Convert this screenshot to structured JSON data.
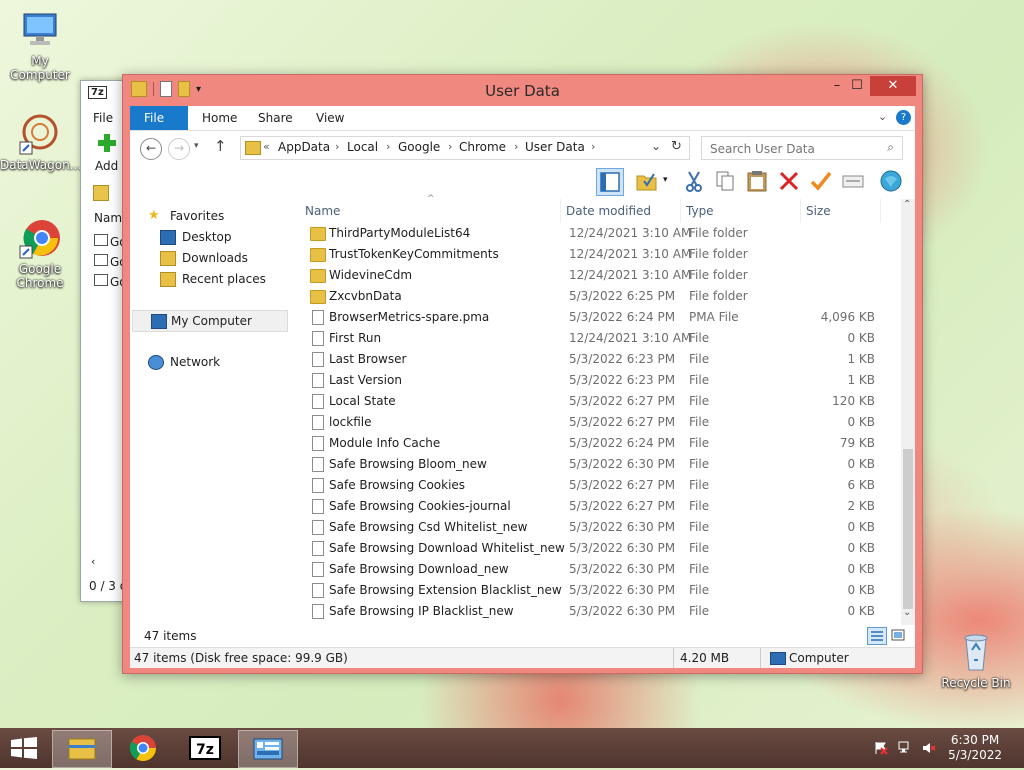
{
  "desktop": {
    "icons": [
      {
        "label": "My Computer"
      },
      {
        "label": "DataWagon..."
      },
      {
        "label": "Google Chrome"
      },
      {
        "label": "Recycle Bin"
      }
    ]
  },
  "back_window": {
    "title_icon": "7z",
    "menu_file": "File",
    "add_label": "Add",
    "col_name": "Name",
    "rows": [
      "Go",
      "Go",
      "Go"
    ],
    "status": "0 / 3 o"
  },
  "window": {
    "title": "User Data",
    "controls": {
      "minimize": "–",
      "maximize": "☐",
      "close": "✕"
    },
    "ribbon_tabs": [
      "File",
      "Home",
      "Share",
      "View"
    ],
    "address": {
      "prefix": "«",
      "crumbs": [
        "AppData",
        "Local",
        "Google",
        "Chrome",
        "User Data"
      ]
    },
    "search_placeholder": "Search User Data",
    "nav": {
      "favorites": "Favorites",
      "desktop": "Desktop",
      "downloads": "Downloads",
      "recent": "Recent places",
      "my_computer": "My Computer",
      "network": "Network"
    },
    "columns": {
      "name": "Name",
      "date": "Date modified",
      "type": "Type",
      "size": "Size"
    },
    "files": [
      {
        "name": "ThirdPartyModuleList64",
        "date": "12/24/2021 3:10 AM",
        "type": "File folder",
        "size": "",
        "kind": "folder"
      },
      {
        "name": "TrustTokenKeyCommitments",
        "date": "12/24/2021 3:10 AM",
        "type": "File folder",
        "size": "",
        "kind": "folder"
      },
      {
        "name": "WidevineCdm",
        "date": "12/24/2021 3:10 AM",
        "type": "File folder",
        "size": "",
        "kind": "folder"
      },
      {
        "name": "ZxcvbnData",
        "date": "5/3/2022 6:25 PM",
        "type": "File folder",
        "size": "",
        "kind": "folder"
      },
      {
        "name": "BrowserMetrics-spare.pma",
        "date": "5/3/2022 6:24 PM",
        "type": "PMA File",
        "size": "4,096 KB",
        "kind": "file"
      },
      {
        "name": "First Run",
        "date": "12/24/2021 3:10 AM",
        "type": "File",
        "size": "0 KB",
        "kind": "file"
      },
      {
        "name": "Last Browser",
        "date": "5/3/2022 6:23 PM",
        "type": "File",
        "size": "1 KB",
        "kind": "file"
      },
      {
        "name": "Last Version",
        "date": "5/3/2022 6:23 PM",
        "type": "File",
        "size": "1 KB",
        "kind": "file"
      },
      {
        "name": "Local State",
        "date": "5/3/2022 6:27 PM",
        "type": "File",
        "size": "120 KB",
        "kind": "file"
      },
      {
        "name": "lockfile",
        "date": "5/3/2022 6:27 PM",
        "type": "File",
        "size": "0 KB",
        "kind": "file"
      },
      {
        "name": "Module Info Cache",
        "date": "5/3/2022 6:24 PM",
        "type": "File",
        "size": "79 KB",
        "kind": "file"
      },
      {
        "name": "Safe Browsing Bloom_new",
        "date": "5/3/2022 6:30 PM",
        "type": "File",
        "size": "0 KB",
        "kind": "file"
      },
      {
        "name": "Safe Browsing Cookies",
        "date": "5/3/2022 6:27 PM",
        "type": "File",
        "size": "6 KB",
        "kind": "file"
      },
      {
        "name": "Safe Browsing Cookies-journal",
        "date": "5/3/2022 6:27 PM",
        "type": "File",
        "size": "2 KB",
        "kind": "file"
      },
      {
        "name": "Safe Browsing Csd Whitelist_new",
        "date": "5/3/2022 6:30 PM",
        "type": "File",
        "size": "0 KB",
        "kind": "file"
      },
      {
        "name": "Safe Browsing Download Whitelist_new",
        "date": "5/3/2022 6:30 PM",
        "type": "File",
        "size": "0 KB",
        "kind": "file"
      },
      {
        "name": "Safe Browsing Download_new",
        "date": "5/3/2022 6:30 PM",
        "type": "File",
        "size": "0 KB",
        "kind": "file"
      },
      {
        "name": "Safe Browsing Extension Blacklist_new",
        "date": "5/3/2022 6:30 PM",
        "type": "File",
        "size": "0 KB",
        "kind": "file"
      },
      {
        "name": "Safe Browsing IP Blacklist_new",
        "date": "5/3/2022 6:30 PM",
        "type": "File",
        "size": "0 KB",
        "kind": "file"
      }
    ],
    "item_count": "47 items",
    "status_left": "47 items (Disk free space: 99.9 GB)",
    "status_size": "4.20 MB",
    "status_location": "Computer"
  },
  "taskbar": {
    "time": "6:30 PM",
    "date": "5/3/2022",
    "apps": [
      "file-explorer",
      "chrome",
      "7-zip",
      "control-panel"
    ],
    "tray_icons": [
      "flag-icon",
      "network-icon",
      "volume-muted-icon"
    ]
  },
  "colors": {
    "window_frame": "#f08880",
    "file_tab": "#1979ca",
    "close_button": "#c7413a"
  }
}
